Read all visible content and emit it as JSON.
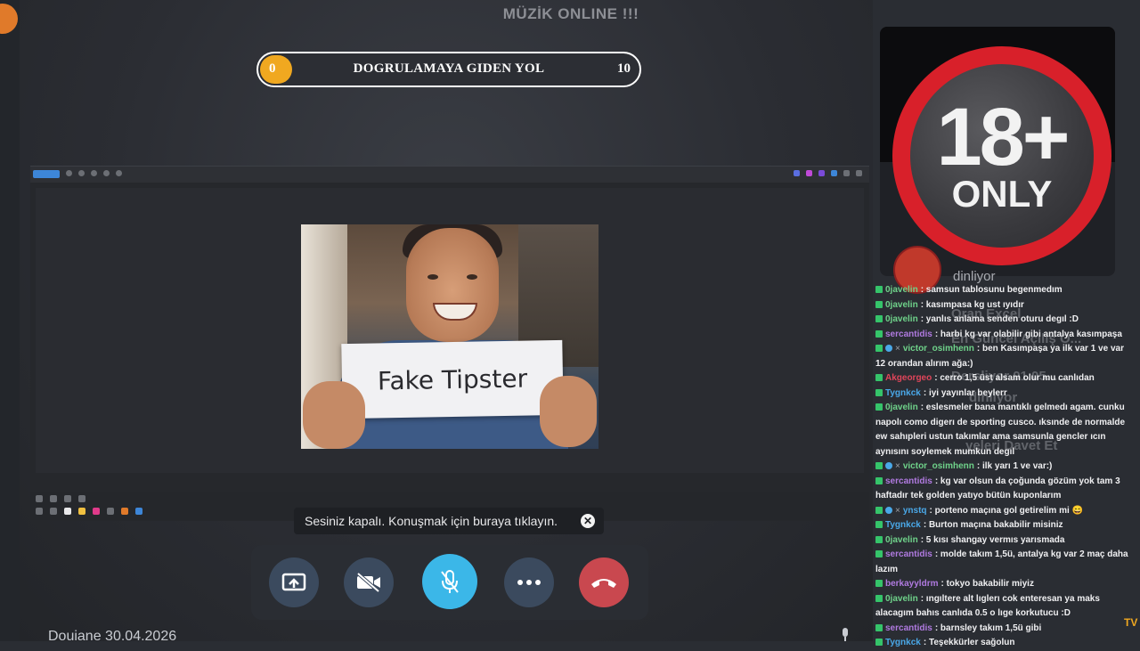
{
  "window": {
    "title": "MÜZİK ONLINE !!!",
    "minimize": "—",
    "maximize": "☐",
    "close": "✕"
  },
  "progress": {
    "start": "0",
    "label": "DOGRULAMAYA GIDEN YOL",
    "end": "10",
    "value": 0,
    "max": 10,
    "fill_color": "#f0a820"
  },
  "shared_screen": {
    "sign_text": "Fake Tipster"
  },
  "toast": {
    "text": "Sesiniz kapalı. Konuşmak için buraya tıklayın.",
    "close": "✕"
  },
  "call_controls": [
    {
      "name": "share-screen",
      "icon": "screen-share-icon"
    },
    {
      "name": "camera-off",
      "icon": "video-off-icon"
    },
    {
      "name": "mute",
      "icon": "mic-off-icon",
      "color": "#3bb7e8"
    },
    {
      "name": "more",
      "icon": "more-icon"
    },
    {
      "name": "hang-up",
      "icon": "phone-hangup-icon",
      "color": "#c9484f"
    }
  ],
  "footer": {
    "date": "Douiane 30.04.2026"
  },
  "badge": {
    "big": "18+",
    "small": "ONLY"
  },
  "right_panel": {
    "listening": "dinliyor"
  },
  "background_texts": [
    "Oran Excel",
    "En Güncel Açılış O...",
    "Dersliyor 01.05.....",
    "dinliyor",
    "yeleri Davet Et"
  ],
  "chat": [
    {
      "user": "0javelin",
      "color": "#6fd28a",
      "text": ": samsun tablosunu begenmedım"
    },
    {
      "user": "0javelin",
      "color": "#6fd28a",
      "text": ": kasımpasa kg ust ıyıdır"
    },
    {
      "user": "0javelin",
      "color": "#6fd28a",
      "text": ": yanlıs anlama senden oturu degıl :D"
    },
    {
      "user": "sercantidis",
      "color": "#b07ae0",
      "text": ": harbi kg var olabilir gibi antalya kasımpaşa"
    },
    {
      "user": "victor_osimhenn",
      "color": "#6fd28a",
      "text": ": ben Kasımpaşa ya ilk var 1 ve var 12 orandan alırım ağa:)",
      "extra": true
    },
    {
      "user": "Akgeorgeo",
      "color": "#e0455a",
      "text": ": cerro 1,5 üst alsam olur mu canlıdan"
    },
    {
      "user": "Tygnkck",
      "color": "#4aa8e8",
      "text": ": iyi yayınlar beylerr"
    },
    {
      "user": "0javelin",
      "color": "#6fd28a",
      "text": ": eslesmeler bana mantıklı gelmedı agam. cunku napolı como digerı de sporting cusco. ıksınde de normalde ew sahıpleri ustun takımlar ama samsunla gencler ıcın aynısını soylemek mumkun degıl"
    },
    {
      "user": "victor_osimhenn",
      "color": "#6fd28a",
      "text": ": ilk yarı 1 ve var:)",
      "extra": true
    },
    {
      "user": "sercantidis",
      "color": "#b07ae0",
      "text": ": kg var olsun da çoğunda gözüm yok tam 3 haftadır tek golden yatıyo bütün kuponlarım"
    },
    {
      "user": "ynstq",
      "color": "#4aa8e8",
      "text": ": porteno maçına gol getirelim mi 😄",
      "extra": true
    },
    {
      "user": "Tygnkck",
      "color": "#4aa8e8",
      "text": ": Burton maçına bakabilir misiniz"
    },
    {
      "user": "0javelin",
      "color": "#6fd28a",
      "text": ": 5 kısı shangay vermıs yarısmada"
    },
    {
      "user": "sercantidis",
      "color": "#b07ae0",
      "text": ": molde takım 1,5ü, antalya kg var 2 maç daha lazım"
    },
    {
      "user": "berkayyldrm",
      "color": "#b07ae0",
      "text": ": tokyo bakabilir miyiz"
    },
    {
      "user": "0javelin",
      "color": "#6fd28a",
      "text": ": ıngıltere alt lıglerı cok enteresan ya maks alacagım bahıs canlıda 0.5 o lıge korkutucu :D"
    },
    {
      "user": "sercantidis",
      "color": "#b07ae0",
      "text": ": barnsley takım 1,5ü gibi"
    },
    {
      "user": "Tygnkck",
      "color": "#4aa8e8",
      "text": ": Teşekkürler sağolun"
    }
  ],
  "watermark": "TV"
}
